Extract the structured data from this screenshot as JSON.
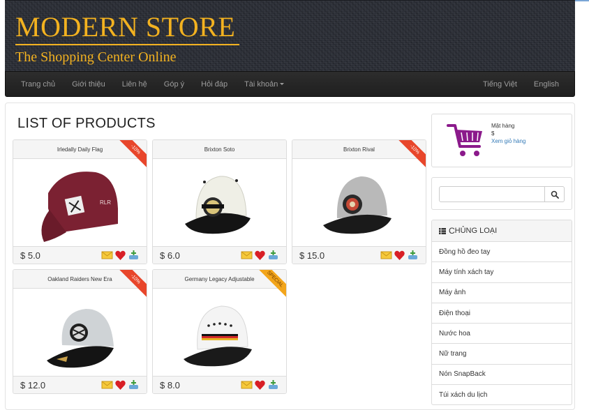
{
  "header": {
    "title": "MODERN STORE",
    "subtitle": "The Shopping Center Online"
  },
  "nav": {
    "left": [
      "Trang chủ",
      "Giới thiệu",
      "Liên hệ",
      "Góp ý",
      "Hỏi đáp",
      "Tài khoản"
    ],
    "right": [
      "Tiếng Việt",
      "English"
    ]
  },
  "main": {
    "title": "LIST OF PRODUCTS",
    "products": [
      {
        "name": "Irledally Daily Flag",
        "price": "$ 5.0",
        "badge": "-10%",
        "badge_color": "#e8462b",
        "cap_color": "#7b2132"
      },
      {
        "name": "Brixton Soto",
        "price": "$ 6.0",
        "badge": "",
        "badge_color": "",
        "cap_color": "#efefe6"
      },
      {
        "name": "Brixton Rival",
        "price": "$ 15.0",
        "badge": "-10%",
        "badge_color": "#e8462b",
        "cap_color": "#b9b9b9"
      },
      {
        "name": "Oakland Raiders New Era",
        "price": "$ 12.0",
        "badge": "-10%",
        "badge_color": "#e8462b",
        "cap_color": "#cfd3d6"
      },
      {
        "name": "Germany Legacy Adjustable",
        "price": "$ 8.0",
        "badge": "SPECIAL",
        "badge_color": "#f3a51b",
        "cap_color": "#f4f4f4"
      }
    ]
  },
  "sidebar": {
    "cart": {
      "items_label": "Mặt hàng",
      "total": "$",
      "view_link": "Xem giỏ hàng",
      "icon": "shopping-cart-icon",
      "icon_color": "#8b1a8b"
    },
    "search": {
      "placeholder": "",
      "icon": "search-icon"
    },
    "categories": {
      "heading_first": "C",
      "heading_rest": "HỦNG LOẠI",
      "items": [
        "Đồng hồ đeo tay",
        "Máy tính xách tay",
        "Máy ảnh",
        "Điện thoại",
        "Nước hoa",
        "Nữ trang",
        "Nón SnapBack",
        "Túi xách du lịch"
      ]
    }
  },
  "colors": {
    "accent": "#f3b220",
    "navbar": "#222222",
    "banner": "#2c2f37"
  }
}
